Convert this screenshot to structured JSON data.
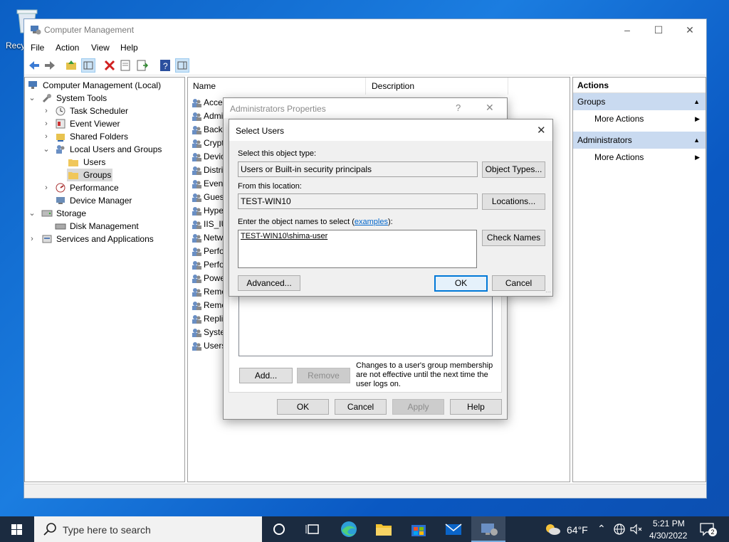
{
  "desktop": {
    "recycle_label": "Recy"
  },
  "window": {
    "title": "Computer Management",
    "menu": [
      "File",
      "Action",
      "View",
      "Help"
    ]
  },
  "tree": {
    "root": "Computer Management (Local)",
    "system_tools": "System Tools",
    "task_scheduler": "Task Scheduler",
    "event_viewer": "Event Viewer",
    "shared_folders": "Shared Folders",
    "local_users_groups": "Local Users and Groups",
    "users": "Users",
    "groups": "Groups",
    "performance": "Performance",
    "device_manager": "Device Manager",
    "storage": "Storage",
    "disk_management": "Disk Management",
    "services_apps": "Services and Applications"
  },
  "list": {
    "col_name": "Name",
    "col_description": "Description",
    "rows": [
      "Acces",
      "Admi",
      "Backu",
      "Crypt",
      "Devic",
      "Distri",
      "Event",
      "Guest",
      "Hype",
      "IIS_IU",
      "Netw",
      "Perfo",
      "Perfo",
      "Powe",
      "Remo",
      "Remo",
      "Replic",
      "Syste",
      "Users"
    ]
  },
  "actions": {
    "header": "Actions",
    "sections": [
      {
        "title": "Groups",
        "more": "More Actions"
      },
      {
        "title": "Administrators",
        "more": "More Actions"
      }
    ]
  },
  "admin_dialog": {
    "title": "Administrators Properties",
    "help_glyph": "?",
    "add": "Add...",
    "remove": "Remove",
    "note": [
      "Changes to a user's group membership",
      "are not effective until the next time the",
      "user logs on."
    ],
    "ok": "OK",
    "cancel": "Cancel",
    "apply": "Apply",
    "help": "Help"
  },
  "select_dialog": {
    "title": "Select Users",
    "object_type_label": "Select this object type:",
    "object_type_value": "Users or Built-in security principals",
    "object_types_btn": "Object Types...",
    "location_label": "From this location:",
    "location_value": "TEST-WIN10",
    "locations_btn": "Locations...",
    "names_label_pre": "Enter the object names to select (",
    "names_label_link": "examples",
    "names_label_post": "):",
    "names_value": "TEST-WIN10\\shima-user",
    "check_names_btn": "Check Names",
    "advanced_btn": "Advanced...",
    "ok": "OK",
    "cancel": "Cancel"
  },
  "taskbar": {
    "search_placeholder": "Type here to search",
    "weather": "64°F",
    "time": "5:21 PM",
    "date": "4/30/2022",
    "notification_count": "2"
  },
  "colors": {
    "accent": "#0078d7",
    "taskbar": "#1b2b40",
    "select_bg": "#d9d9d9"
  }
}
